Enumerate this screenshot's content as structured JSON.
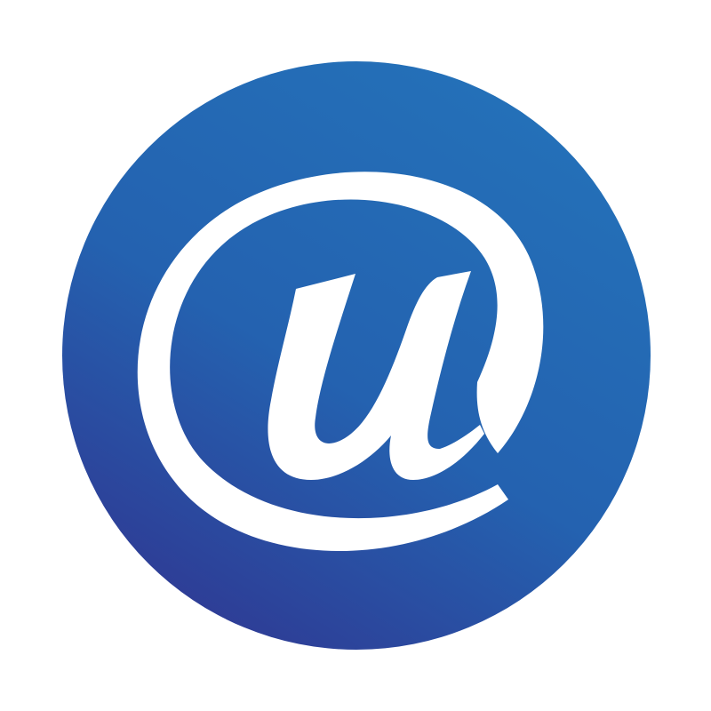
{
  "logo": {
    "icon": "at-sign-icon",
    "glyph_text": "@u",
    "colors": {
      "background": "#ffffff",
      "circle_light": "#2470b8",
      "circle_mid": "#2462b0",
      "circle_dark": "#2e3d96",
      "glyph": "#ffffff"
    }
  }
}
